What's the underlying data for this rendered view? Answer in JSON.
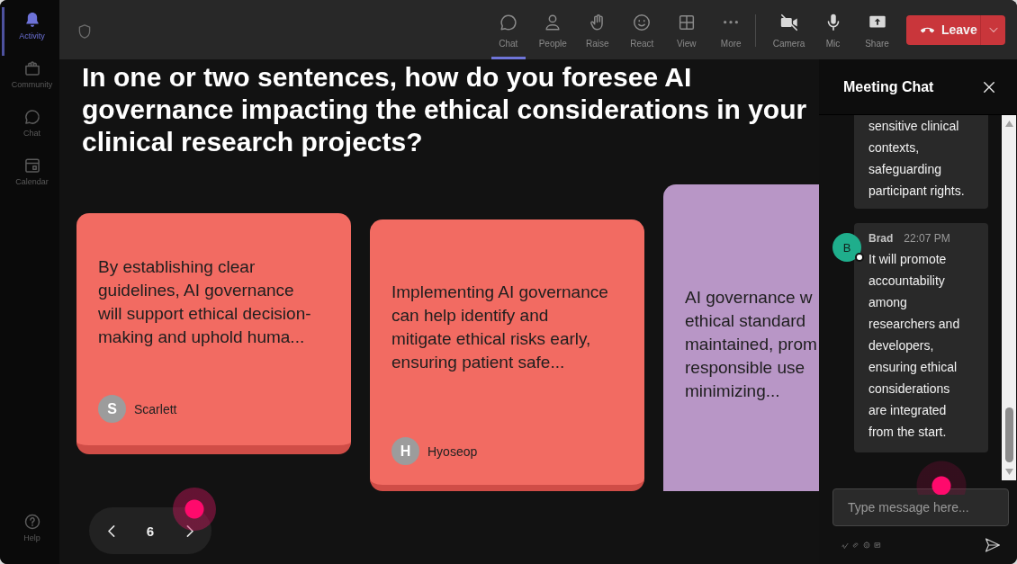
{
  "sidebar": {
    "items": [
      {
        "label": "Activity",
        "selected": true
      },
      {
        "label": "Community",
        "selected": false
      },
      {
        "label": "Chat",
        "selected": false
      },
      {
        "label": "Calendar",
        "selected": false
      }
    ],
    "help": {
      "label": "Help"
    }
  },
  "toolbar": {
    "items": [
      {
        "label": "Chat",
        "selected": true
      },
      {
        "label": "People",
        "selected": false
      },
      {
        "label": "Raise",
        "selected": false
      },
      {
        "label": "React",
        "selected": false
      },
      {
        "label": "View",
        "selected": false
      },
      {
        "label": "More",
        "selected": false
      }
    ],
    "devices": [
      {
        "label": "Camera"
      },
      {
        "label": "Mic"
      },
      {
        "label": "Share"
      }
    ],
    "leave": {
      "label": "Leave"
    }
  },
  "question": "In one or two sentences, how do you foresee AI governance impacting the ethical considerations in your clinical research projects?",
  "cards": [
    {
      "color": "#f26b62",
      "lines": [
        "By establishing clear",
        "guidelines, AI governance",
        "will support ethical decision-",
        "making and uphold huma..."
      ],
      "author": {
        "initial": "S",
        "name": "Scarlett"
      }
    },
    {
      "color": "#f26b62",
      "lines": [
        "Implementing AI governance",
        "can help identify and",
        "mitigate ethical risks early,",
        "ensuring patient safe..."
      ],
      "author": {
        "initial": "H",
        "name": "Hyoseop"
      }
    },
    {
      "color": "#b896c6",
      "lines": [
        "AI governance w",
        "ethical standard",
        "maintained, prom",
        "responsible use",
        "minimizing..."
      ]
    }
  ],
  "pager": {
    "page": "6"
  },
  "chat": {
    "title": "Meeting Chat",
    "messages": [
      {
        "text": "sensitive clinical contexts, safeguarding participant rights."
      },
      {
        "author": "Brad",
        "initial": "B",
        "color": "#1fae8c",
        "time": "22:07 PM",
        "text": "It will promote accountability among researchers and developers, ensuring ethical considerations are integrated from the start."
      }
    ],
    "input": {
      "placeholder": "Type message here..."
    }
  }
}
